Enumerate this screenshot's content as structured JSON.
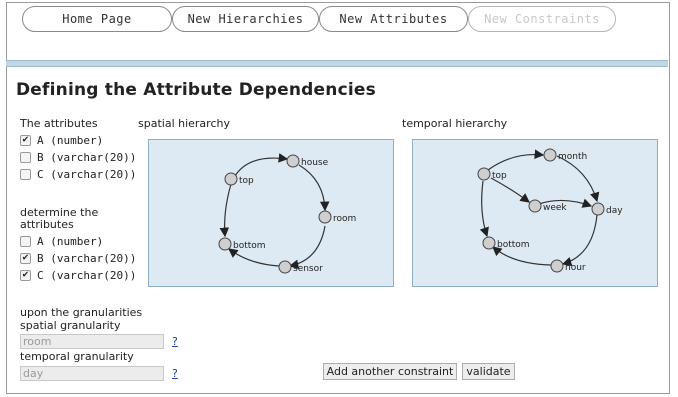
{
  "nav": {
    "home": "Home Page",
    "hierarchies": "New Hierarchies",
    "attributes": "New Attributes",
    "constraints": "New Constraints"
  },
  "page_title": "Defining the Attribute Dependencies",
  "attributes_section": {
    "label": "The attributes",
    "items": [
      {
        "label": "A (number)",
        "checked": true
      },
      {
        "label": "B (varchar(20))",
        "checked": false
      },
      {
        "label": "C (varchar(20))",
        "checked": false
      }
    ]
  },
  "determine_section": {
    "label_line1": "determine the",
    "label_line2": "attributes",
    "items": [
      {
        "label": "A (number)",
        "checked": false
      },
      {
        "label": "B (varchar(20))",
        "checked": true
      },
      {
        "label": "C (varchar(20))",
        "checked": true
      }
    ]
  },
  "spatial": {
    "label": "spatial hierarchy",
    "nodes": {
      "top": "top",
      "house": "house",
      "room": "room",
      "sensor": "sensor",
      "bottom": "bottom"
    }
  },
  "temporal": {
    "label": "temporal hierarchy",
    "nodes": {
      "top": "top",
      "month": "month",
      "week": "week",
      "day": "day",
      "hour": "hour",
      "bottom": "bottom"
    }
  },
  "granularities": {
    "label": "upon the granularities",
    "spatial_label": "spatial granularity",
    "spatial_value": "room",
    "temporal_label": "temporal granularity",
    "temporal_value": "day",
    "help": "?"
  },
  "buttons": {
    "add": "Add another constraint",
    "validate": "validate"
  },
  "colors": {
    "panel_bg": "#ddeaf4",
    "panel_border": "#8eaec4",
    "divider": "#bfd6e3",
    "link": "#1a3f99"
  }
}
